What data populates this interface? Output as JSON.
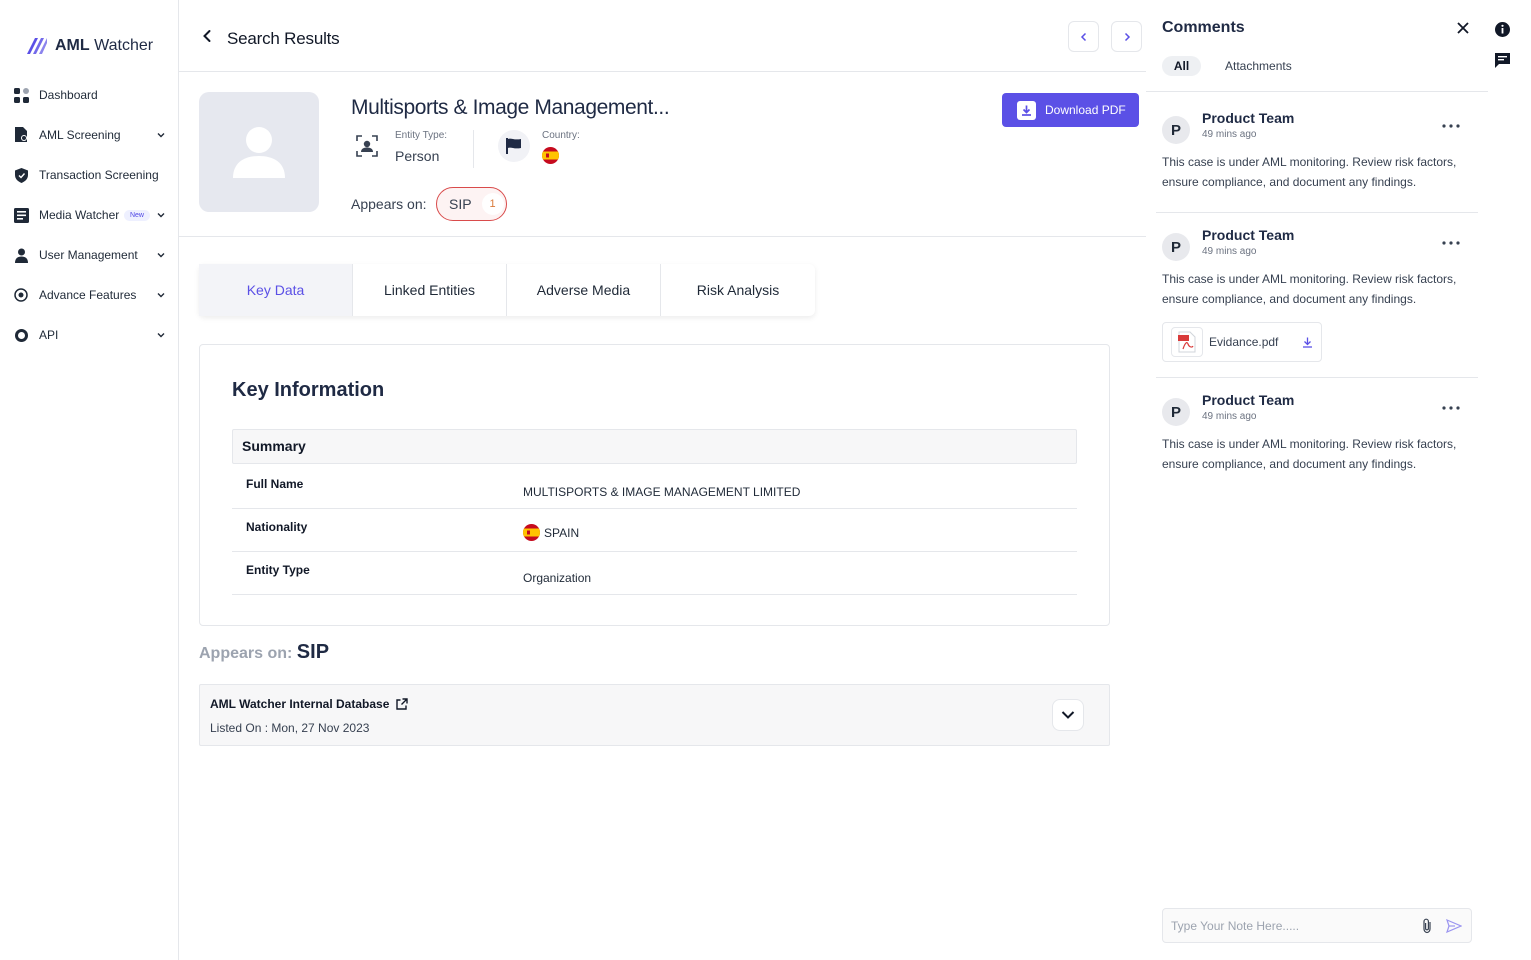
{
  "brand": {
    "name_bold": "AML",
    "name_rest": "Watcher"
  },
  "sidebar": {
    "items": [
      {
        "label": "Dashboard",
        "icon": "dashboard-icon",
        "expandable": false
      },
      {
        "label": "AML Screening",
        "icon": "aml-screening-icon",
        "expandable": true
      },
      {
        "label": "Transaction Screening",
        "icon": "shield-icon",
        "expandable": false
      },
      {
        "label": "Media Watcher",
        "icon": "media-watcher-icon",
        "expandable": true,
        "badge": "New"
      },
      {
        "label": "User Management",
        "icon": "user-icon",
        "expandable": true
      },
      {
        "label": "Advance Features",
        "icon": "advance-features-icon",
        "expandable": true
      },
      {
        "label": "API",
        "icon": "api-icon",
        "expandable": true
      }
    ]
  },
  "header": {
    "title": "Search Results"
  },
  "entity": {
    "name": "Multisports & Image Management...",
    "entity_type_label": "Entity Type:",
    "entity_type_value": "Person",
    "country_label": "Country:",
    "appears_on_label": "Appears on:",
    "appears_on_list": "SIP",
    "appears_on_count": "1",
    "download_label": "Download PDF"
  },
  "tabs": [
    {
      "label": "Key Data",
      "active": true
    },
    {
      "label": "Linked Entities",
      "active": false
    },
    {
      "label": "Adverse Media",
      "active": false
    },
    {
      "label": "Risk Analysis",
      "active": false
    }
  ],
  "key_info": {
    "title": "Key Information",
    "summary_label": "Summary",
    "rows": [
      {
        "key": "Full Name",
        "value": "MULTISPORTS & IMAGE MANAGEMENT LIMITED"
      },
      {
        "key": "Nationality",
        "value": "SPAIN"
      },
      {
        "key": "Entity Type",
        "value": "Organization"
      }
    ]
  },
  "appears_section": {
    "label": "Appears on:",
    "list": "SIP",
    "database_name": "AML Watcher Internal Database",
    "listed_on": "Listed On : Mon, 27 Nov 2023"
  },
  "comments": {
    "title": "Comments",
    "tab_all": "All",
    "tab_attachments": "Attachments",
    "items": [
      {
        "initial": "P",
        "author": "Product Team",
        "time": "49 mins ago",
        "text": "This case is under AML monitoring. Review risk factors, ensure compliance, and document any findings."
      },
      {
        "initial": "P",
        "author": "Product Team",
        "time": "49 mins ago",
        "text": "This case is under AML monitoring. Review risk factors, ensure compliance, and document any findings.",
        "attachment": "Evidance.pdf"
      },
      {
        "initial": "P",
        "author": "Product Team",
        "time": "49 mins ago",
        "text": "This case is under AML monitoring. Review risk factors, ensure compliance, and document any findings."
      }
    ],
    "note_placeholder": "Type Your Note Here....."
  },
  "colors": {
    "accent": "#5b50e6",
    "danger": "#d94b4b",
    "navy": "#1f2a44"
  }
}
